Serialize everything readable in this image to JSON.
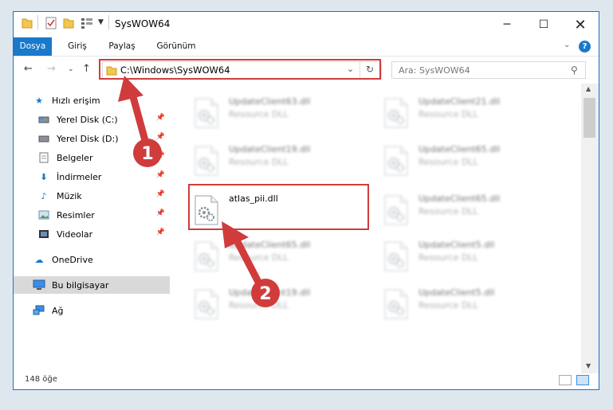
{
  "window": {
    "title": "SysWOW64"
  },
  "ribbon": {
    "tabs": [
      "Dosya",
      "Giriş",
      "Paylaş",
      "Görünüm"
    ]
  },
  "address": {
    "path": "C:\\Windows\\SysWOW64",
    "search_placeholder": "Ara: SysWOW64"
  },
  "sidebar": {
    "items": [
      {
        "label": "Hızlı erişim",
        "icon": "star-icon"
      },
      {
        "label": "Yerel Disk (C:)",
        "icon": "drive-icon",
        "pinned": true
      },
      {
        "label": "Yerel Disk (D:)",
        "icon": "drive-icon",
        "pinned": true
      },
      {
        "label": "Belgeler",
        "icon": "document-icon",
        "pinned": true
      },
      {
        "label": "İndirmeler",
        "icon": "download-icon",
        "pinned": true
      },
      {
        "label": "Müzik",
        "icon": "music-icon",
        "pinned": true
      },
      {
        "label": "Resimler",
        "icon": "pictures-icon",
        "pinned": true
      },
      {
        "label": "Videolar",
        "icon": "video-icon",
        "pinned": true
      },
      {
        "label": "OneDrive",
        "icon": "cloud-icon"
      },
      {
        "label": "Bu bilgisayar",
        "icon": "computer-icon",
        "selected": true
      },
      {
        "label": "Ağ",
        "icon": "network-icon"
      }
    ]
  },
  "files": {
    "left": [
      {
        "name": "UpdateClient63.dll",
        "desc": "Resource DLL"
      },
      {
        "name": "UpdateClient19.dll",
        "desc": "Resource DLL"
      },
      {
        "name": "atlas_pii.dll",
        "desc": ""
      },
      {
        "name": "UpdateClient65.dll",
        "desc": "Resource DLL"
      },
      {
        "name": "UpdateClient19.dll",
        "desc": "Resource DLL"
      }
    ],
    "right": [
      {
        "name": "UpdateClient21.dll",
        "desc": "Resource DLL"
      },
      {
        "name": "UpdateClient65.dll",
        "desc": "Resource DLL"
      },
      {
        "name": "UpdateClient65.dll",
        "desc": "Resource DLL"
      },
      {
        "name": "UpdateClient5.dll",
        "desc": "Resource DLL"
      },
      {
        "name": "UpdateClient5.dll",
        "desc": "Resource DLL"
      }
    ]
  },
  "status": {
    "count": "148 öğe"
  },
  "annotations": {
    "step1": "1",
    "step2": "2"
  },
  "colors": {
    "accent": "#1979ca",
    "annotation": "#d03c3c"
  }
}
